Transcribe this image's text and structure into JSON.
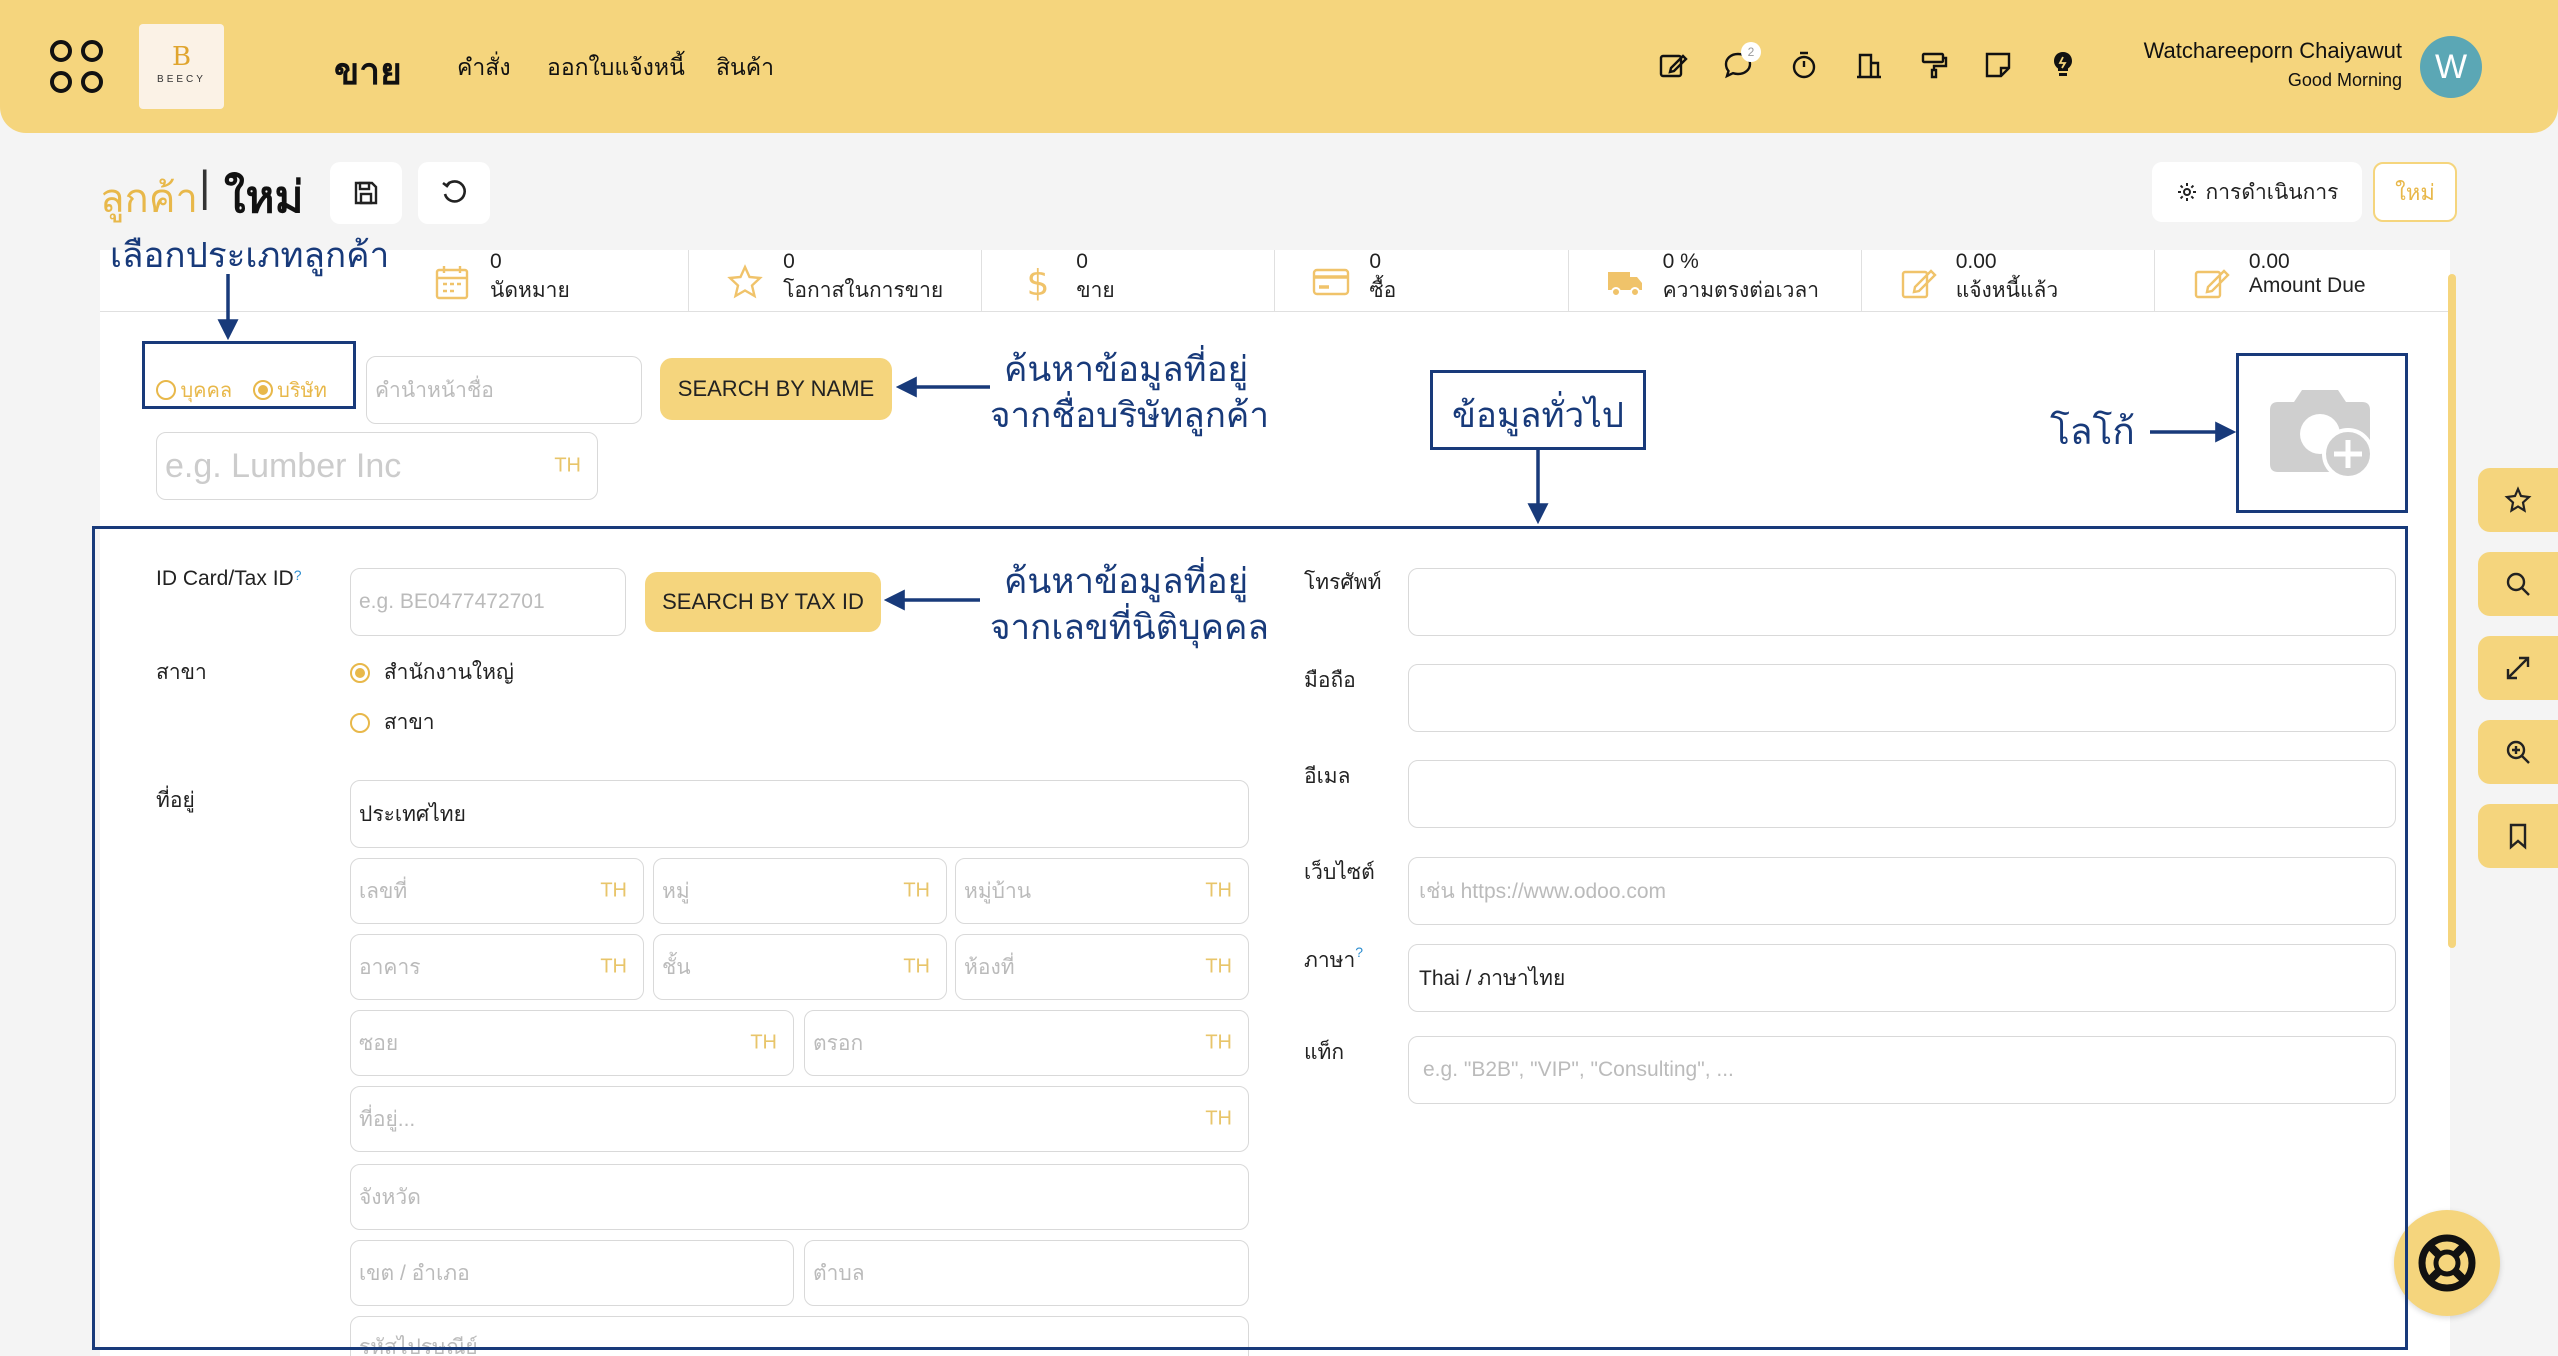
{
  "header": {
    "app_name": "ขาย",
    "logo_text": "BEECY",
    "logo_letter": "B",
    "menu": [
      "คำสั่ง",
      "ออกใบแจ้งหนี้",
      "สินค้า"
    ],
    "user_name": "Watchareeporn Chaiyawut",
    "greeting": "Good Morning",
    "avatar_letter": "W",
    "chat_badge": "2"
  },
  "breadcrumb": {
    "parent": "ลูกค้า",
    "separator": "|",
    "current": "ใหม่"
  },
  "actions": {
    "action_menu": "การดำเนินการ",
    "new_button": "ใหม่"
  },
  "stats": [
    {
      "icon": "calendar-icon",
      "value": "0",
      "label": "นัดหมาย"
    },
    {
      "icon": "star-icon",
      "value": "0",
      "label": "โอกาสในการขาย"
    },
    {
      "icon": "dollar-icon",
      "value": "0",
      "label": "ขาย"
    },
    {
      "icon": "credit-card-icon",
      "value": "0",
      "label": "ซื้อ"
    },
    {
      "icon": "truck-icon",
      "value": "0 %",
      "label": "ความตรงต่อเวลา"
    },
    {
      "icon": "edit-icon",
      "value": "0.00",
      "label": "แจ้งหนี้แล้ว"
    },
    {
      "icon": "edit-icon",
      "value": "0.00",
      "label": "Amount Due"
    }
  ],
  "customer_type": {
    "individual": "บุคคล",
    "company": "บริษัท",
    "selected": "company"
  },
  "title_placeholder": "คำนำหน้าชื่อ",
  "name_placeholder": "e.g. Lumber Inc",
  "lang_tag": "TH",
  "search_by_name": "SEARCH BY NAME",
  "search_by_tax": "SEARCH BY TAX ID",
  "form_left": {
    "tax_id_label": "ID Card/Tax ID",
    "tax_id_placeholder": "e.g. BE0477472701",
    "branch_label": "สาขา",
    "branch_options": [
      "สำนักงานใหญ่",
      "สาขา"
    ],
    "branch_selected": "สำนักงานใหญ่",
    "address_label": "ที่อยู่",
    "country": "ประเทศไทย",
    "address_fields": {
      "house_no": "เลขที่",
      "moo": "หมู่",
      "village": "หมู่บ้าน",
      "building": "อาคาร",
      "floor": "ชั้น",
      "room": "ห้องที่",
      "soi": "ซอย",
      "trok": "ตรอก",
      "address": "ที่อยู่...",
      "province": "จังหวัด",
      "district": "เขต / อำเภอ",
      "subdistrict": "ตำบล",
      "postcode": "รหัสไปรษณีย์"
    }
  },
  "form_right": {
    "phone_label": "โทรศัพท์",
    "mobile_label": "มือถือ",
    "email_label": "อีเมล",
    "website_label": "เว็บไซต์",
    "website_placeholder": "เช่น https://www.odoo.com",
    "language_label": "ภาษา",
    "language_value": "Thai / ภาษาไทย",
    "tags_label": "แท็ก",
    "tags_placeholder": "e.g. \"B2B\", \"VIP\", \"Consulting\", ..."
  },
  "annotations": {
    "customer_type": "เลือกประเภทลูกค้า",
    "search_name_1": "ค้นหาข้อมูลที่อยู่",
    "search_name_2": "จากชื่อบริษัทลูกค้า",
    "general_info": "ข้อมูลทั่วไป",
    "logo": "โลโก้",
    "search_tax_1": "ค้นหาข้อมูลที่อยู่",
    "search_tax_2": "จากเลขที่นิติบุคคล"
  },
  "colors": {
    "brand_yellow": "#f5d57d",
    "accent_gold": "#e8b84a",
    "annotation_navy": "#183a7a",
    "avatar": "#5ba7b5"
  }
}
